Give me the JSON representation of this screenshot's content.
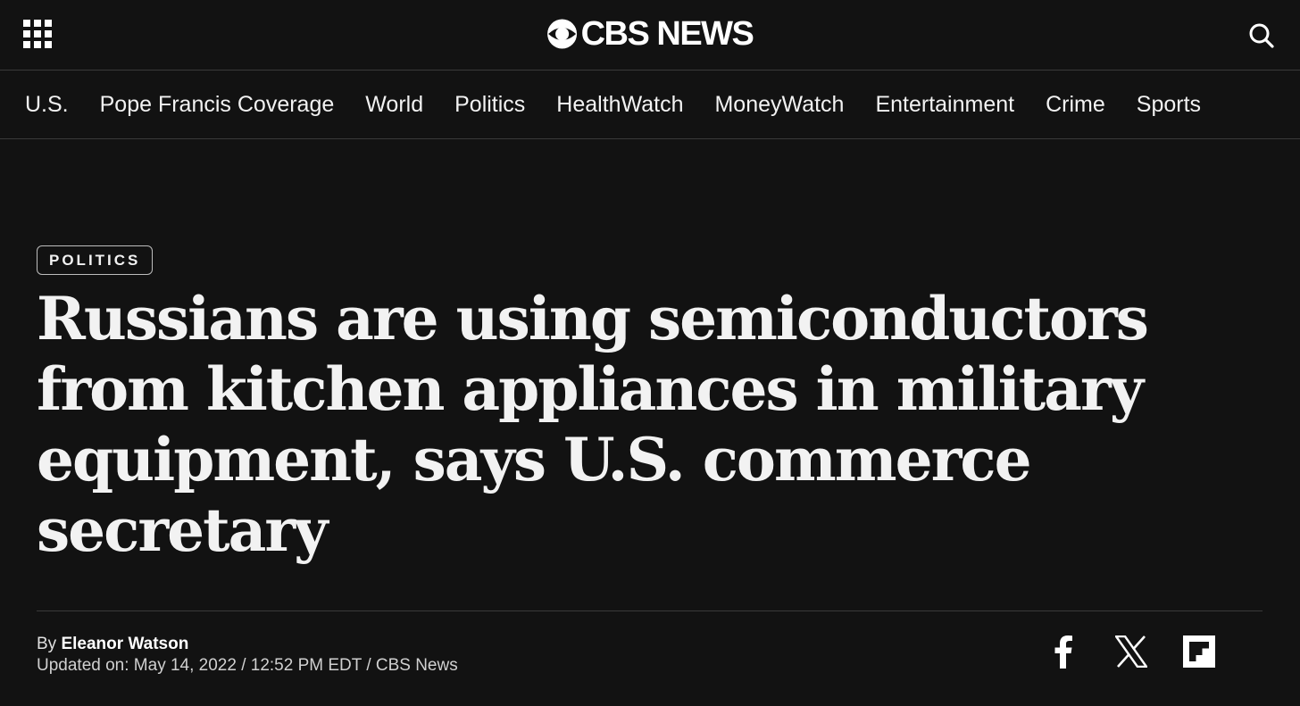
{
  "header": {
    "logo_text": "CBS NEWS",
    "menu_icon": "grid-menu-icon",
    "search_icon": "search-icon"
  },
  "nav": {
    "items": [
      {
        "label": "U.S."
      },
      {
        "label": "Pope Francis Coverage"
      },
      {
        "label": "World"
      },
      {
        "label": "Politics"
      },
      {
        "label": "HealthWatch"
      },
      {
        "label": "MoneyWatch"
      },
      {
        "label": "Entertainment"
      },
      {
        "label": "Crime"
      },
      {
        "label": "Sports"
      }
    ]
  },
  "article": {
    "category": "POLITICS",
    "headline": "Russians are using semiconductors from kitchen appliances in military equipment, says U.S. commerce secretary",
    "byline_prefix": "By",
    "author": "Eleanor Watson",
    "updated": "Updated on: May 14, 2022 / 12:52 PM EDT / CBS News"
  },
  "share": {
    "icons": [
      "facebook-icon",
      "x-icon",
      "flipboard-icon"
    ]
  },
  "colors": {
    "background": "#121212",
    "text": "#f2f2f2",
    "divider": "#3a3a3a"
  }
}
